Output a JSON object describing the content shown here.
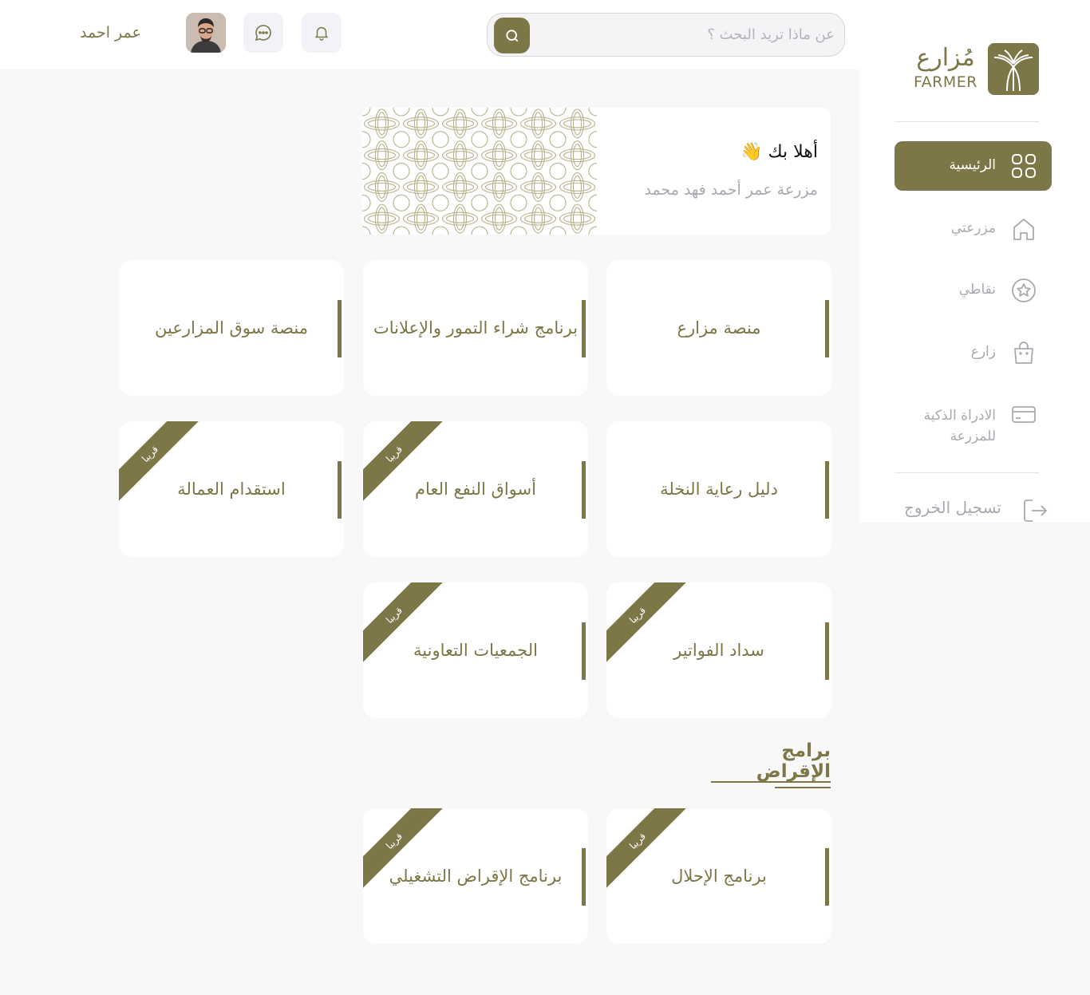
{
  "header": {
    "search_placeholder": "عن ماذا تريد البحث ؟",
    "user_name": "عمر احمد",
    "icons": {
      "search": "search-icon",
      "chat": "chat-icon",
      "notifications": "bell-icon"
    }
  },
  "brand": {
    "name_ar": "مُزارع",
    "name_en": "FARMER"
  },
  "sidebar": {
    "items": [
      {
        "label": "الرئيسية",
        "icon": "grid-icon",
        "active": true
      },
      {
        "label": "مزرعتي",
        "icon": "home-icon",
        "active": false
      },
      {
        "label": "نقاطي",
        "icon": "star-icon",
        "active": false
      },
      {
        "label": "زارع",
        "icon": "shopping-bag-icon",
        "active": false
      },
      {
        "label": "الادراة الذكية للمزرعة",
        "icon": "card-icon",
        "active": false
      }
    ],
    "logout_label": "تسجيل الخروج"
  },
  "welcome": {
    "title": "أهلا بك 👋",
    "subtitle": "مزرعة عمر أحمد فهد محمد"
  },
  "services": [
    {
      "label": "منصة مزارع",
      "soon": false
    },
    {
      "label": "برنامج شراء التمور والإعلانات",
      "soon": false
    },
    {
      "label": "منصة سوق المزارعين",
      "soon": false
    },
    {
      "label": "دليل رعاية النخلة",
      "soon": false
    },
    {
      "label": "أسواق النفع العام",
      "soon": true
    },
    {
      "label": "استقدام العمالة",
      "soon": true
    },
    {
      "label": "سداد الفواتير",
      "soon": true
    },
    {
      "label": "الجمعيات التعاونية",
      "soon": true
    }
  ],
  "loans": {
    "title": "برامج الإقراض",
    "items": [
      {
        "label": "برنامج الإحلال",
        "soon": true
      },
      {
        "label": "برنامج الإقراض التشغيلي",
        "soon": true
      }
    ]
  },
  "soon_label": "قريبا",
  "colors": {
    "accent": "#7d7646",
    "muted": "#a9a9b1",
    "background": "#f8f8f8"
  }
}
